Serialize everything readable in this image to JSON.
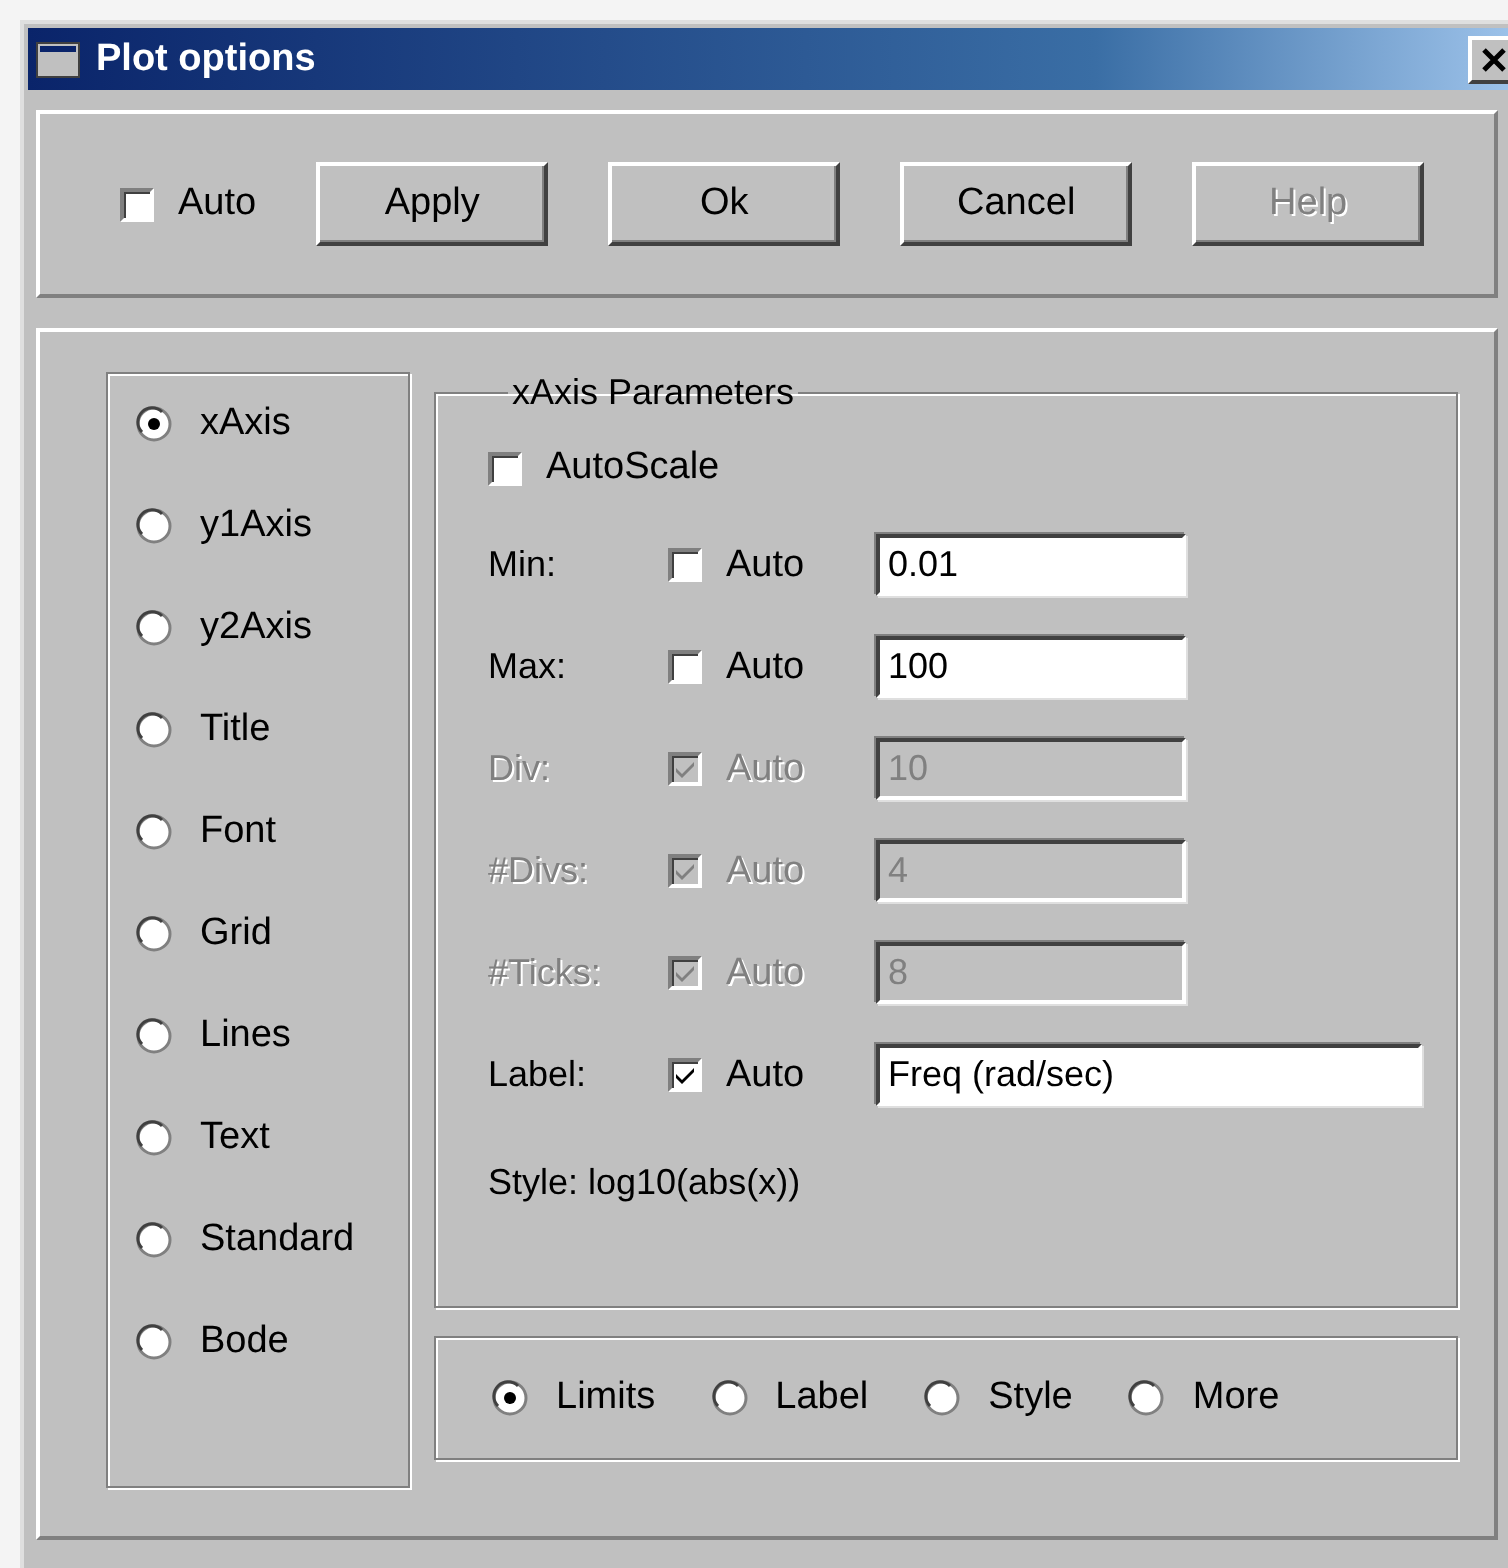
{
  "window": {
    "title": "Plot options"
  },
  "toolbar": {
    "auto": {
      "label": "Auto",
      "checked": false
    },
    "buttons": [
      {
        "label": "Apply",
        "disabled": false
      },
      {
        "label": "Ok",
        "disabled": false
      },
      {
        "label": "Cancel",
        "disabled": false
      },
      {
        "label": "Help",
        "disabled": true
      }
    ]
  },
  "categories": [
    {
      "label": "xAxis",
      "selected": true
    },
    {
      "label": "y1Axis",
      "selected": false
    },
    {
      "label": "y2Axis",
      "selected": false
    },
    {
      "label": "Title",
      "selected": false
    },
    {
      "label": "Font",
      "selected": false
    },
    {
      "label": "Grid",
      "selected": false
    },
    {
      "label": "Lines",
      "selected": false
    },
    {
      "label": "Text",
      "selected": false
    },
    {
      "label": "Standard",
      "selected": false
    },
    {
      "label": "Bode",
      "selected": false
    }
  ],
  "parameters": {
    "title": "xAxis Parameters",
    "autoscale": {
      "label": "AutoScale",
      "checked": false
    },
    "rows": [
      {
        "label": "Min:",
        "auto_label": "Auto",
        "auto_checked": false,
        "value": "0.01",
        "disabled": false,
        "kind": "number"
      },
      {
        "label": "Max:",
        "auto_label": "Auto",
        "auto_checked": false,
        "value": "100",
        "disabled": false,
        "kind": "number"
      },
      {
        "label": "Div:",
        "auto_label": "Auto",
        "auto_checked": true,
        "value": "10",
        "disabled": true,
        "kind": "number"
      },
      {
        "label": "#Divs:",
        "auto_label": "Auto",
        "auto_checked": true,
        "value": "4",
        "disabled": true,
        "kind": "number"
      },
      {
        "label": "#Ticks:",
        "auto_label": "Auto",
        "auto_checked": true,
        "value": "8",
        "disabled": true,
        "kind": "number"
      },
      {
        "label": "Label:",
        "auto_label": "Auto",
        "auto_checked": true,
        "value": "Freq (rad/sec)",
        "disabled": false,
        "kind": "text"
      }
    ],
    "style_text": "Style: log10(abs(x))"
  },
  "view_tabs": [
    {
      "label": "Limits",
      "selected": true
    },
    {
      "label": "Label",
      "selected": false
    },
    {
      "label": "Style",
      "selected": false
    },
    {
      "label": "More",
      "selected": false
    }
  ]
}
